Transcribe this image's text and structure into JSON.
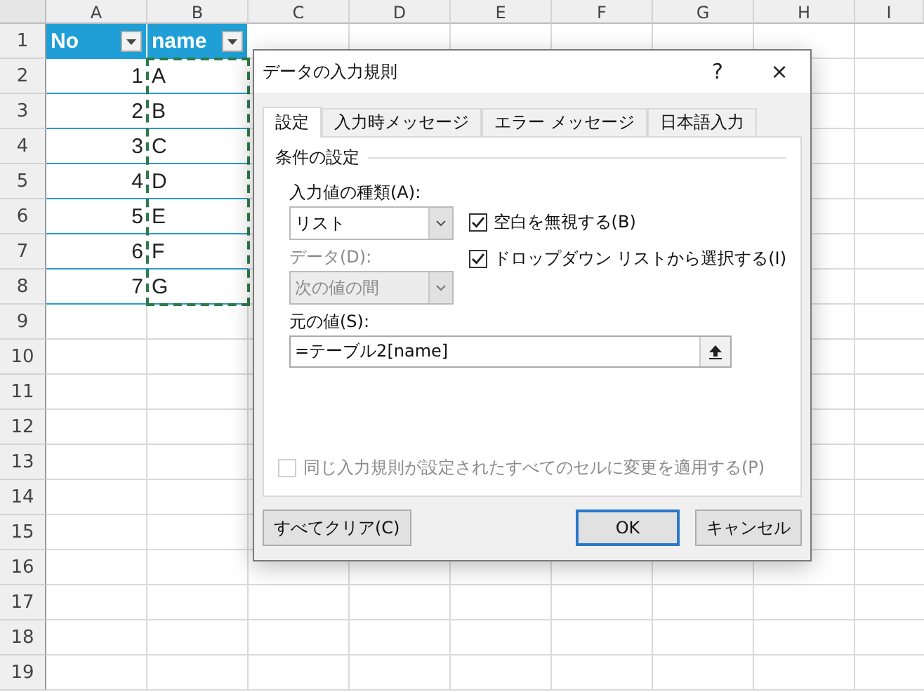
{
  "sheet": {
    "column_headers": [
      "A",
      "B",
      "C",
      "D",
      "E",
      "F",
      "G",
      "H",
      "I"
    ],
    "row_headers": [
      "1",
      "2",
      "3",
      "4",
      "5",
      "6",
      "7",
      "8",
      "9",
      "10",
      "11",
      "12",
      "13",
      "14",
      "15",
      "16",
      "17",
      "18",
      "19"
    ],
    "table": {
      "columns": [
        {
          "label": "No"
        },
        {
          "label": "name"
        }
      ],
      "rows": [
        [
          "1",
          "A"
        ],
        [
          "2",
          "B"
        ],
        [
          "3",
          "C"
        ],
        [
          "4",
          "D"
        ],
        [
          "5",
          "E"
        ],
        [
          "6",
          "F"
        ],
        [
          "7",
          "G"
        ]
      ]
    }
  },
  "dialog": {
    "title": "データの入力規則",
    "help": "?",
    "close": "×",
    "tabs": [
      {
        "label": "設定",
        "selected": true
      },
      {
        "label": "入力時メッセージ",
        "selected": false
      },
      {
        "label": "エラー メッセージ",
        "selected": false
      },
      {
        "label": "日本語入力",
        "selected": false
      }
    ],
    "group_title": "条件の設定",
    "allow": {
      "label": "入力値の種類(A):",
      "value": "リスト",
      "disabled": false
    },
    "data": {
      "label": "データ(D):",
      "value": "次の値の間",
      "disabled": true
    },
    "checkboxes": [
      {
        "label": "空白を無視する(B)",
        "checked": true
      },
      {
        "label": "ドロップダウン リストから選択する(I)",
        "checked": true
      }
    ],
    "source": {
      "label": "元の値(S):",
      "value": "=テーブル2[name]"
    },
    "apply_all": {
      "label": "同じ入力規則が設定されたすべてのセルに変更を適用する(P)",
      "checked": false,
      "disabled": true
    },
    "buttons": [
      {
        "label": "すべてクリア(C)",
        "default": false
      },
      {
        "label": "OK",
        "default": true
      },
      {
        "label": "キャンセル",
        "default": false
      }
    ]
  }
}
